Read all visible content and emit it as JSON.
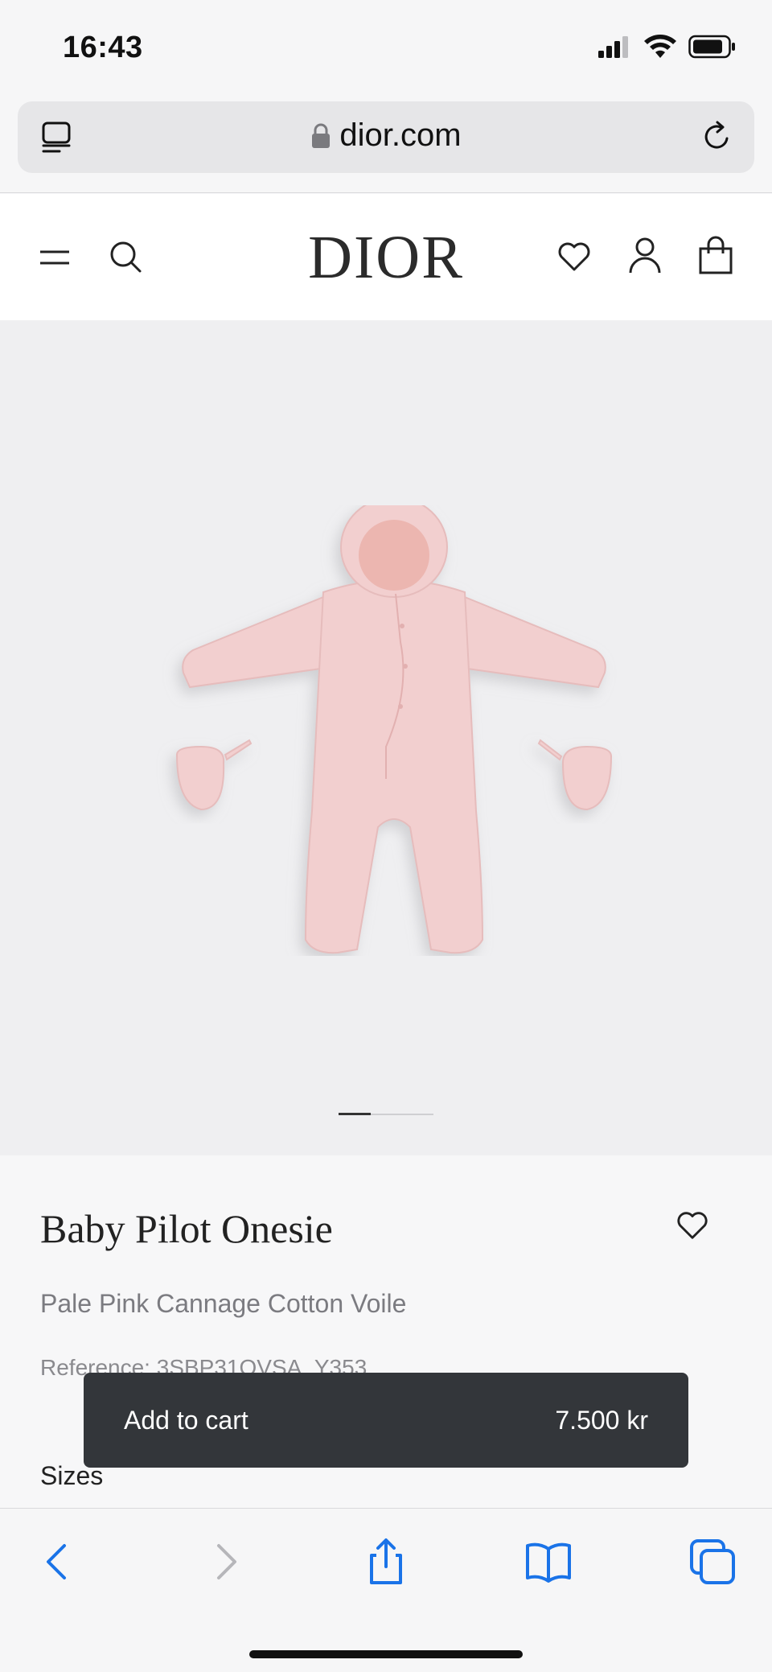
{
  "status_bar": {
    "time": "16:43",
    "icons": [
      "cellular-signal-icon",
      "wifi-icon",
      "battery-icon"
    ]
  },
  "browser": {
    "url": "dior.com",
    "icons": {
      "reader": "reader-mode-icon",
      "lock": "lock-icon",
      "reload": "reload-icon"
    },
    "toolbar": [
      "back-icon",
      "forward-icon",
      "share-icon",
      "bookmarks-icon",
      "tabs-icon"
    ],
    "accent_color": "#1a73e8"
  },
  "site_header": {
    "logo": "DIOR",
    "icons": [
      "menu-icon",
      "search-icon",
      "wishlist-heart-icon",
      "account-icon",
      "shopping-bag-icon"
    ]
  },
  "product": {
    "image_alt": "Pale pink baby onesie with hood and mittens",
    "title": "Baby Pilot Onesie",
    "subtitle": "Pale Pink Cannage Cotton Voile",
    "reference": "Reference: 3SBP31OVSA_Y353",
    "sizes_label": "Sizes",
    "carousel": {
      "current": 1,
      "total": 3
    }
  },
  "cart": {
    "label": "Add to cart",
    "price": "7.500 kr"
  },
  "colors": {
    "product_pink": "#f2cfcf",
    "button_dark": "#33363a",
    "media_bg": "#efeff1"
  }
}
